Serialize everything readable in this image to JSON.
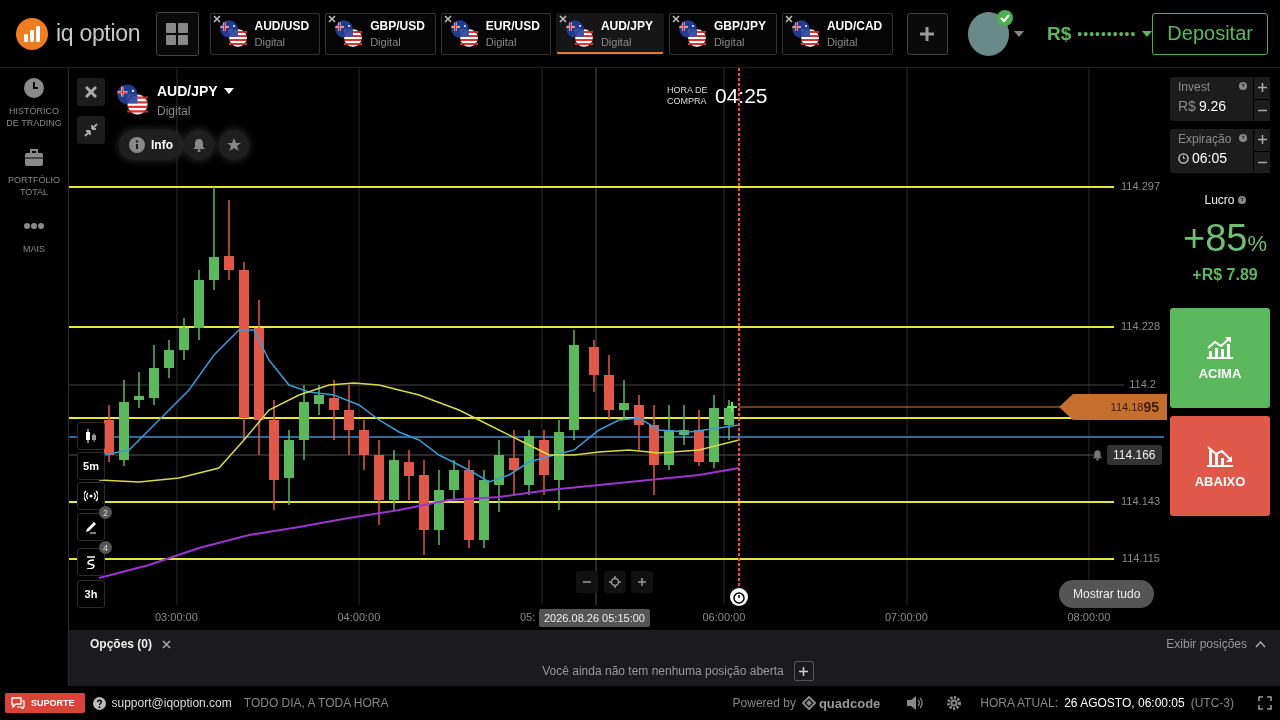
{
  "header": {
    "logo": "iq option",
    "tabs": [
      {
        "pair": "AUD/USD",
        "type": "Digital",
        "selected": false
      },
      {
        "pair": "GBP/USD",
        "type": "Digital",
        "selected": false
      },
      {
        "pair": "EUR/USD",
        "type": "Digital",
        "selected": false
      },
      {
        "pair": "AUD/JPY",
        "type": "Digital",
        "selected": true
      },
      {
        "pair": "GBP/JPY",
        "type": "Digital",
        "selected": false
      },
      {
        "pair": "AUD/CAD",
        "type": "Digital",
        "selected": false
      }
    ],
    "balance": {
      "currency": "R$",
      "masked": "••••••••••"
    },
    "deposit": "Depositar"
  },
  "sidebar": {
    "items": [
      {
        "label": "HISTÓRICO DE TRADING",
        "kind": "clock"
      },
      {
        "label": "PORTFÓLIO TOTAL",
        "kind": "briefcase"
      },
      {
        "label": "MAIS",
        "kind": "dots"
      }
    ]
  },
  "chart": {
    "asset": "AUD/JPY",
    "type": "Digital",
    "info": "Info",
    "purchase_label": "HORA DE COMPRA",
    "countdown": "04:25",
    "price_labels": [
      "114.297",
      "114.228",
      "114.2",
      "114.143",
      "114.115"
    ],
    "current_price": "114.18**95**",
    "alert_price": "114.166",
    "time_labels": [
      "03:00:00",
      "04:00:00",
      "05:",
      "06:00:00",
      "07:00:00",
      "08:00:00"
    ],
    "crosshair_time": "2026.08.26 05:15:00",
    "tools": [
      {
        "kind": "candles"
      },
      {
        "kind": "text",
        "label": "5m"
      },
      {
        "kind": "signal"
      },
      {
        "kind": "pencil",
        "badge": "2"
      },
      {
        "kind": "wave",
        "badge": "4"
      },
      {
        "kind": "text",
        "label": "3h"
      }
    ],
    "show_all": "Mostrar tudo"
  },
  "trade": {
    "invest": {
      "label": "Invest",
      "currency": "R$",
      "value": "9.26"
    },
    "expiration": {
      "label": "Expiração",
      "value": "06:05"
    },
    "profit": {
      "label": "Lucro",
      "percent": "+85",
      "percent_sign": "%",
      "amount": "+R$ 7.89"
    },
    "buttons": [
      {
        "label": "ACIMA",
        "kind": "up"
      },
      {
        "label": "ABAIXO",
        "kind": "down"
      }
    ]
  },
  "positions": {
    "tab": "Opções (0)",
    "toggle": "Exibir posições",
    "empty": "Você ainda não tem nenhuma posição aberta"
  },
  "footer": {
    "support": "SUPORTE",
    "email": "support@iqoption.com",
    "hours": "TODO DIA, A TODA HORA",
    "powered": "Powered by",
    "brand": "quadcode",
    "time_label": "HORA ATUAL:",
    "time": "26 AGOSTO, 06:00:05",
    "timezone": "(UTC-3)"
  }
}
